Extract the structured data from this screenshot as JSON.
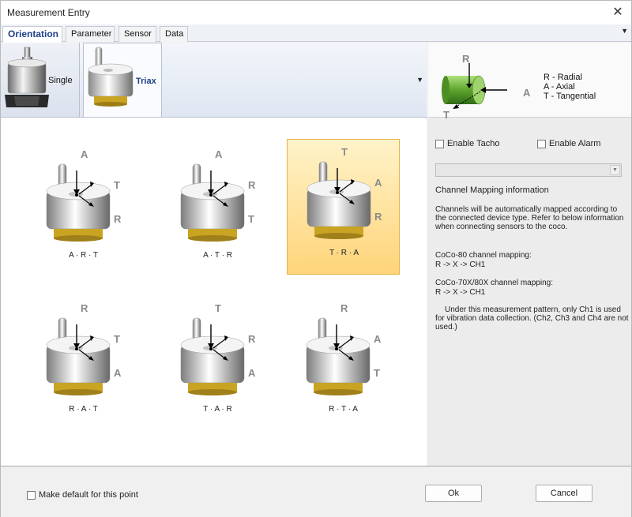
{
  "window": {
    "title": "Measurement Entry",
    "close_glyph": "✕"
  },
  "tabs": [
    {
      "label": "Orientation",
      "active": true
    },
    {
      "label": "Parameter",
      "active": false
    },
    {
      "label": "Sensor",
      "active": false
    },
    {
      "label": "Data",
      "active": false
    }
  ],
  "sensor_types": [
    {
      "label": "Single",
      "selected": false
    },
    {
      "label": "Triax",
      "selected": true
    }
  ],
  "orientations": [
    {
      "caption": "A · R · T",
      "top": "A",
      "upper_right": "T",
      "lower_right": "R",
      "selected": false
    },
    {
      "caption": "A · T · R",
      "top": "A",
      "upper_right": "R",
      "lower_right": "T",
      "selected": false
    },
    {
      "caption": "T · R · A",
      "top": "T",
      "upper_right": "A",
      "lower_right": "R",
      "selected": true
    },
    {
      "caption": "R · A · T",
      "top": "R",
      "upper_right": "T",
      "lower_right": "A",
      "selected": false
    },
    {
      "caption": "T · A · R",
      "top": "T",
      "upper_right": "R",
      "lower_right": "A",
      "selected": false
    },
    {
      "caption": "R · T · A",
      "top": "R",
      "upper_right": "A",
      "lower_right": "T",
      "selected": false
    }
  ],
  "legend": {
    "axis_r": "R",
    "axis_a": "A",
    "axis_t": "T",
    "lines": [
      "R - Radial",
      "A - Axial",
      "T - Tangential"
    ]
  },
  "options": {
    "enable_tacho": {
      "label": "Enable Tacho",
      "checked": false
    },
    "enable_alarm": {
      "label": "Enable Alarm",
      "checked": false
    }
  },
  "channel_combo": {
    "value": ""
  },
  "info": {
    "heading": "Channel Mapping information",
    "p1": "Channels will be automatically mapped according to the connected device type. Refer to below information when connecting sensors to the coco.",
    "p2_title": "CoCo-80 channel mapping:",
    "p2_value": "R -> X -> CH1",
    "p3_title": "CoCo-70X/80X channel mapping:",
    "p3_value": "R -> X -> CH1",
    "p4": "Under this measurement pattern, only Ch1 is used for vibration data collection. (Ch2, Ch3 and Ch4 are not used.)"
  },
  "footer": {
    "make_default": {
      "label": "Make default for this point",
      "checked": false
    },
    "ok_label": "Ok",
    "cancel_label": "Cancel"
  },
  "colors": {
    "active_tab_text": "#1f3f8a",
    "selected_cell_bg": "#ffd47a",
    "axis_label": "#8a8a8a",
    "legend_cylinder": "#6cbf3a"
  }
}
